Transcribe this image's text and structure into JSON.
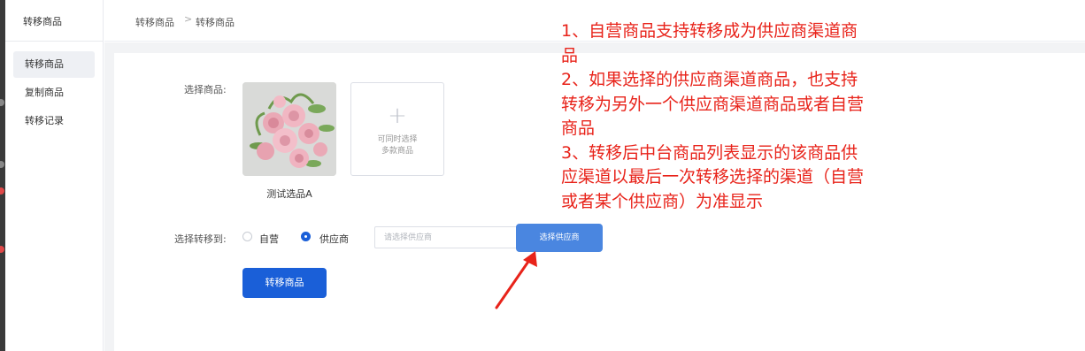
{
  "sidebar": {
    "title": "转移商品",
    "items": [
      {
        "label": "转移商品",
        "active": true
      },
      {
        "label": "复制商品",
        "active": false
      },
      {
        "label": "转移记录",
        "active": false
      }
    ]
  },
  "breadcrumb": {
    "items": [
      "转移商品",
      "转移商品"
    ],
    "separator": ">"
  },
  "form": {
    "select_product_label": "选择商品:",
    "product": {
      "name": "测试选品A",
      "image": "pink-roses-photo"
    },
    "add_hint_line1": "可同时选择",
    "add_hint_line2": "多款商品",
    "add_icon": "plus-icon",
    "transfer_to_label": "选择转移到:",
    "options": [
      {
        "label": "自营",
        "checked": false
      },
      {
        "label": "供应商",
        "checked": true
      }
    ],
    "supplier_placeholder": "请选择供应商",
    "select_supplier_button": "选择供应商",
    "submit_button": "转移商品"
  },
  "annotation": {
    "color": "#e8231a",
    "lines": [
      "1、自营商品支持转移成为供应商渠道商",
      "品",
      "2、如果选择的供应商渠道商品，也支持",
      "转移为另外一个供应商渠道商品或者自营",
      "商品",
      "3、转移后中台商品列表显示的该商品供",
      "应渠道以最后一次转移选择的渠道（自营",
      "或者某个供应商）为准显示"
    ]
  },
  "colors": {
    "primary": "#1a5fd8",
    "secondary_button": "#4a86e0",
    "annotation": "#e8231a"
  }
}
